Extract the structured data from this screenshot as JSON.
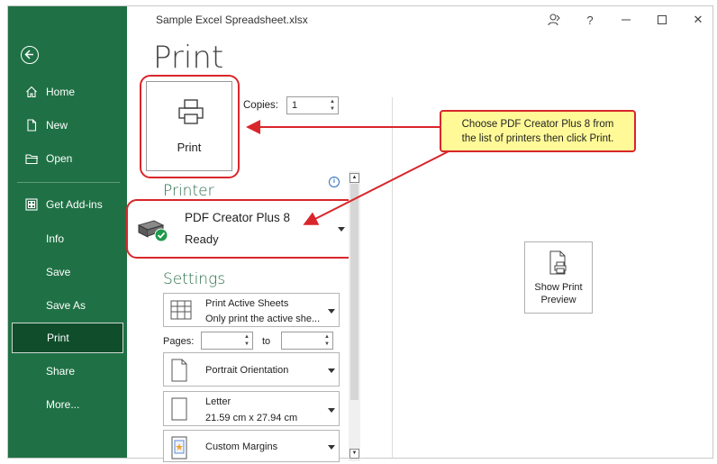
{
  "window": {
    "title": "Sample Excel Spreadsheet.xlsx",
    "icons": [
      "coauthor-icon",
      "help-icon",
      "minimize-icon",
      "maximize-icon",
      "close-icon"
    ],
    "help_glyph": "?",
    "close_glyph": "✕"
  },
  "sidebar": {
    "bg_color": "#1f7145",
    "items": [
      {
        "label": "Home",
        "icon": "home-icon"
      },
      {
        "label": "New",
        "icon": "new-document-icon"
      },
      {
        "label": "Open",
        "icon": "folder-icon"
      },
      {
        "label": "Get Add-ins",
        "icon": "add-ins-icon"
      },
      {
        "label": "Info"
      },
      {
        "label": "Save"
      },
      {
        "label": "Save As"
      },
      {
        "label": "Print",
        "active": true
      },
      {
        "label": "Share"
      },
      {
        "label": "More..."
      }
    ]
  },
  "print": {
    "title": "Print",
    "button_label": "Print",
    "copies_label": "Copies:",
    "copies_value": "1"
  },
  "printer": {
    "section_title": "Printer",
    "name": "PDF Creator Plus 8",
    "status": "Ready",
    "info_glyph": "i"
  },
  "settings": {
    "section_title": "Settings",
    "print_what": {
      "line1": "Print Active Sheets",
      "line2": "Only print the active she..."
    },
    "pages_label": "Pages:",
    "to_label": "to",
    "orientation": "Portrait Orientation",
    "paper": {
      "line1": "Letter",
      "line2": "21.59 cm x 27.94 cm"
    },
    "margins": "Custom Margins"
  },
  "preview": {
    "line1": "Show Print",
    "line2": "Preview"
  },
  "callout": {
    "line1": "Choose PDF Creator Plus 8 from",
    "line2": "the list of printers then click Print."
  },
  "colors": {
    "highlight": "#d9262a",
    "callout_bg": "#fffa97",
    "accent_green": "#1f7145",
    "section_title": "#2b6e4a"
  }
}
